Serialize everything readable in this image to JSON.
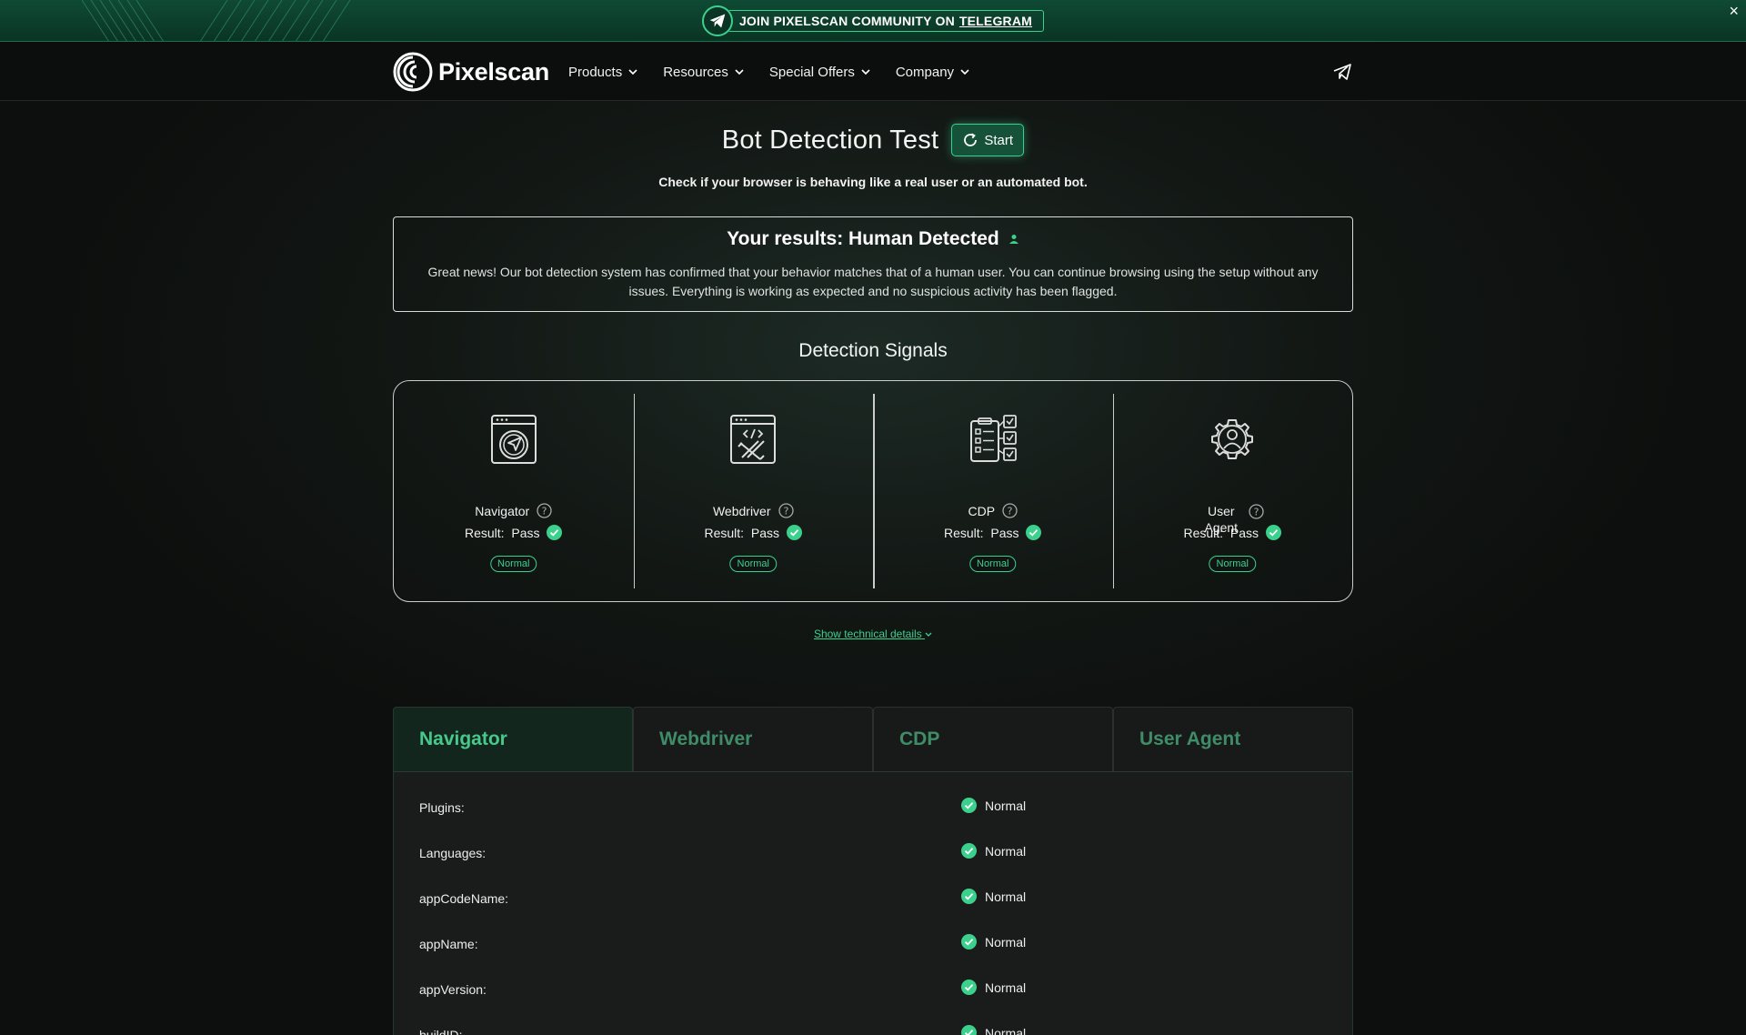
{
  "banner": {
    "text": "JOIN PIXELSCAN COMMUNITY ON",
    "link": "TELEGRAM",
    "close": "×"
  },
  "nav": {
    "brand": "Pixelscan",
    "items": [
      {
        "label": "Products"
      },
      {
        "label": "Resources"
      },
      {
        "label": "Special Offers"
      },
      {
        "label": "Company"
      }
    ]
  },
  "header": {
    "title": "Bot Detection Test",
    "start_label": "Start",
    "subtitle": "Check if your browser is behaving like a real user or an automated bot."
  },
  "results": {
    "title": "Your results: Human Detected",
    "text": "Great news! Our bot detection system has confirmed that your behavior matches that of a human user. You can continue browsing using the setup without any issues. Everything is working as expected and no suspicious activity has been flagged."
  },
  "signals": {
    "title": "Detection Signals",
    "result_prefix": "Result:",
    "items": [
      {
        "name": "Navigator",
        "result": "Pass",
        "badge": "Normal",
        "icon": "browser-navigation-icon"
      },
      {
        "name": "Webdriver",
        "result": "Pass",
        "badge": "Normal",
        "icon": "code-tools-icon"
      },
      {
        "name": "CDP",
        "result": "Pass",
        "badge": "Normal",
        "icon": "checklist-icon"
      },
      {
        "name": "User Agent",
        "result": "Pass",
        "badge": "Normal",
        "icon": "user-gear-icon"
      }
    ],
    "tech_link": "Show technical details"
  },
  "tabs": {
    "items": [
      {
        "label": "Navigator"
      },
      {
        "label": "Webdriver"
      },
      {
        "label": "CDP"
      },
      {
        "label": "User Agent"
      }
    ],
    "active": "Navigator"
  },
  "details": {
    "rows": [
      {
        "label": "Plugins:",
        "status": "Normal"
      },
      {
        "label": "Languages:",
        "status": "Normal"
      },
      {
        "label": "appCodeName:",
        "status": "Normal"
      },
      {
        "label": "appName:",
        "status": "Normal"
      },
      {
        "label": "appVersion:",
        "status": "Normal"
      },
      {
        "label": "buildID:",
        "status": "Normal"
      }
    ]
  },
  "colors": {
    "accent": "#3bd18d",
    "banner": "#0f4a34",
    "background": "#121714"
  }
}
